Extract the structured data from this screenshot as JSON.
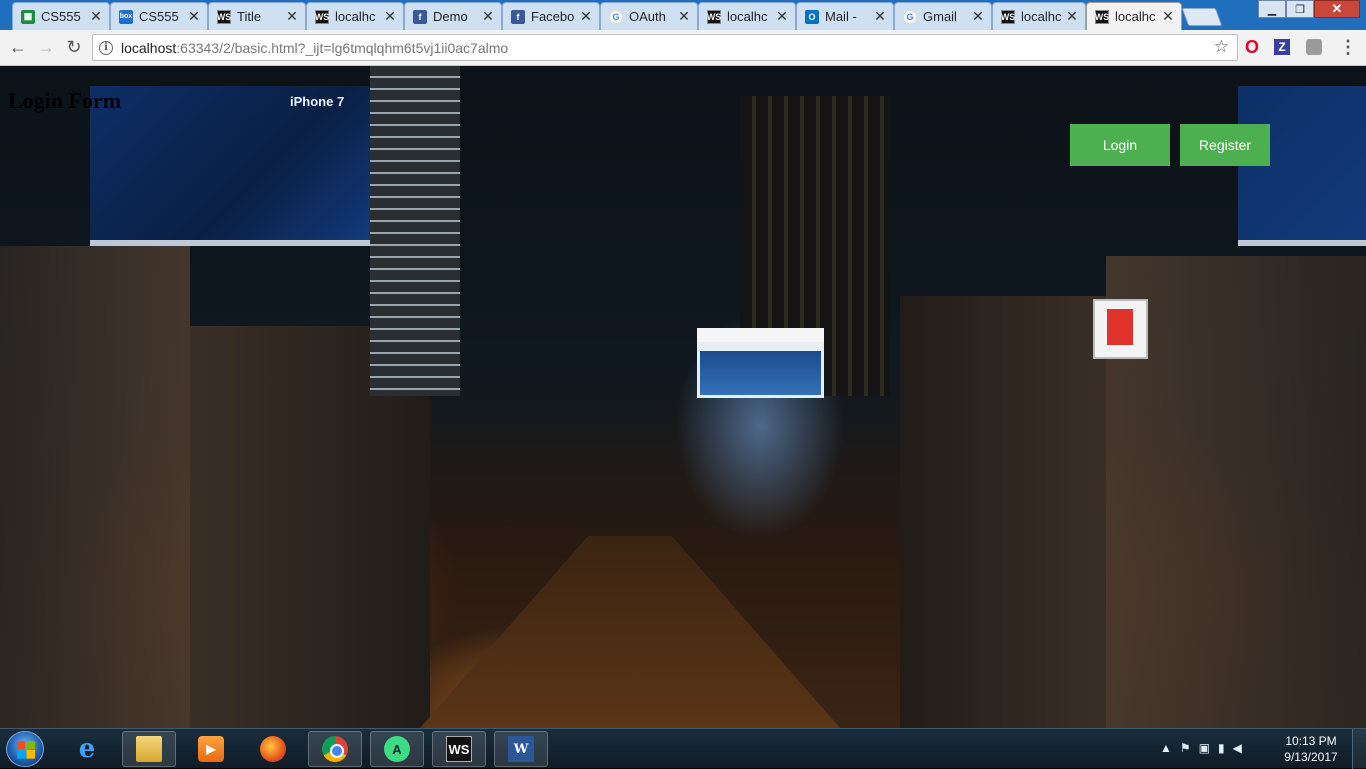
{
  "browser": {
    "tabs": [
      {
        "label": "CS555",
        "icon": "sheets-icon",
        "active": false
      },
      {
        "label": "CS555",
        "icon": "box-icon",
        "active": false
      },
      {
        "label": "Title",
        "icon": "webstorm-icon",
        "active": false
      },
      {
        "label": "localhc",
        "icon": "webstorm-icon",
        "active": false
      },
      {
        "label": "Demo",
        "icon": "facebook-icon",
        "active": false
      },
      {
        "label": "Facebo",
        "icon": "facebook-icon",
        "active": false
      },
      {
        "label": "OAuth",
        "icon": "google-icon",
        "active": false
      },
      {
        "label": "localhc",
        "icon": "webstorm-icon",
        "active": false
      },
      {
        "label": "Mail - ",
        "icon": "outlook-icon",
        "active": false
      },
      {
        "label": "Gmail",
        "icon": "google-icon",
        "active": false
      },
      {
        "label": "localhc",
        "icon": "webstorm-icon",
        "active": false
      },
      {
        "label": "localhc",
        "icon": "webstorm-icon",
        "active": true
      }
    ],
    "address": {
      "host": "localhost",
      "rest": ":63343/2/basic.html?_ijt=lg6tmqlqhm6t5vj1ii0ac7almo"
    }
  },
  "page": {
    "title": "Login Form",
    "login_label": "Login",
    "register_label": "Register",
    "background": {
      "billboard_text": "iPhone 7"
    },
    "colors": {
      "button": "#4caf50",
      "button_text": "#ffffff"
    }
  },
  "taskbar": {
    "pinned": [
      "internet-explorer-icon",
      "file-explorer-icon",
      "media-player-icon",
      "firefox-icon",
      "chrome-icon",
      "android-studio-icon",
      "webstorm-icon",
      "word-icon"
    ],
    "time": "10:13 PM",
    "date": "9/13/2017"
  }
}
